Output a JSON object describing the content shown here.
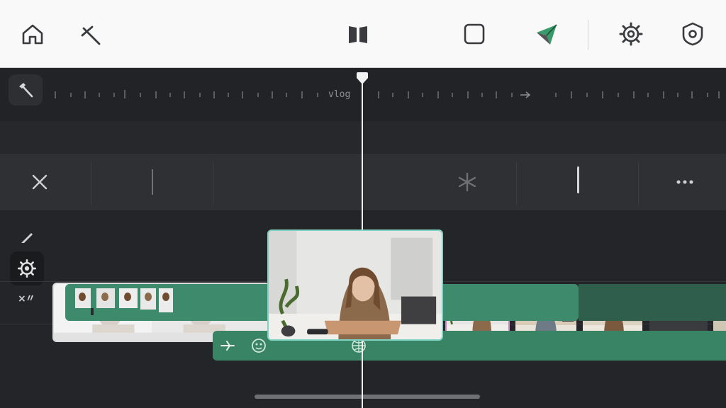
{
  "toolbar": {
    "buttons": [
      {
        "name": "home-button",
        "icon": "home-icon"
      },
      {
        "name": "trim-button",
        "icon": "trim-icon"
      },
      {
        "name": "layout-button",
        "icon": "columns-icon"
      },
      {
        "name": "canvas-button",
        "icon": "square-icon"
      },
      {
        "name": "share-button",
        "icon": "send-icon"
      },
      {
        "name": "settings-button",
        "icon": "gear-icon"
      },
      {
        "name": "preferences-button",
        "icon": "shield-gear-icon"
      }
    ]
  },
  "ruler": {
    "label": "vlog",
    "tool_icon": "hammer-icon"
  },
  "edit_row": {
    "tools": [
      {
        "name": "delete-button",
        "icon": "close-icon"
      },
      {
        "name": "split-button",
        "icon": "asterisk-icon"
      },
      {
        "name": "more-button",
        "icon": "more-dots-icon"
      }
    ]
  },
  "sidebar": {
    "tools": [
      {
        "name": "pen-button",
        "icon": "pen-icon"
      },
      {
        "name": "clip-settings-button",
        "icon": "gear-icon"
      }
    ],
    "mute_label": "×〃"
  },
  "tracks": {
    "video_clips": [
      {
        "name": "clip-intro",
        "selected": false
      },
      {
        "name": "clip-woman-desk",
        "selected": true
      },
      {
        "name": "clip-woman-sitting",
        "selected": false
      },
      {
        "name": "clip-man-interview",
        "selected": false
      },
      {
        "name": "clip-woman-plants",
        "selected": false
      },
      {
        "name": "clip-search",
        "icon": "search-icon"
      }
    ],
    "audio_track_2_icons": [
      "transition-icon",
      "face-icon",
      "globe-icon"
    ]
  },
  "colors": {
    "accent": "#3d8b6c",
    "selection": "#7fd3c4",
    "send_arrow": "#3a9a6b",
    "toolbar_bg": "#f9f9f9",
    "timeline_bg": "#242528"
  }
}
